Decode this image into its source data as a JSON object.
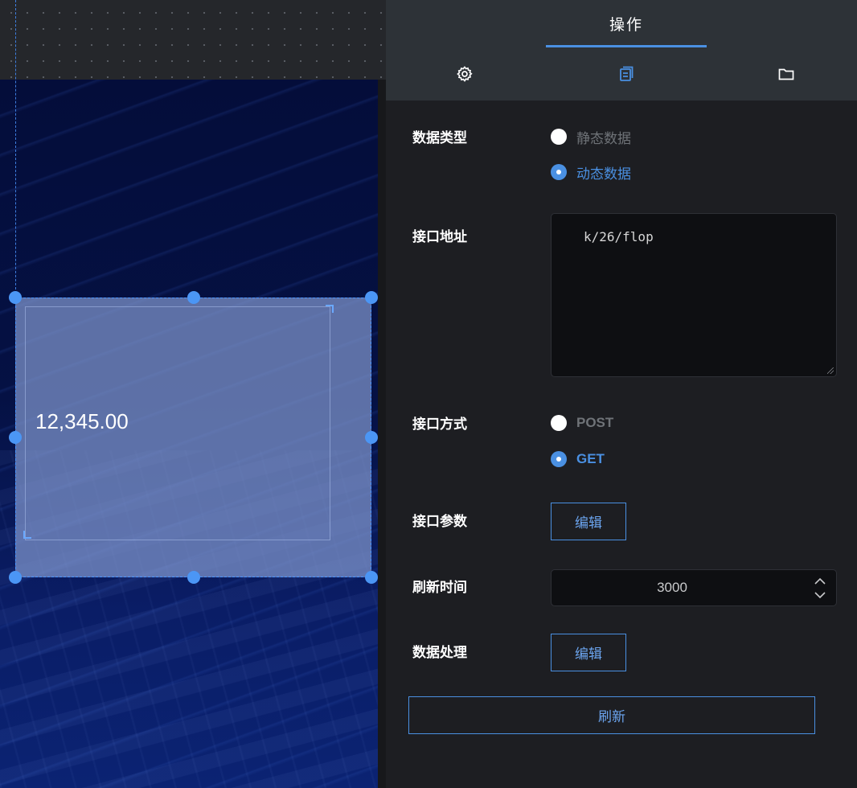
{
  "canvas": {
    "component": {
      "value": "12,345.00"
    }
  },
  "panel": {
    "title": "操作",
    "tabs": [
      {
        "icon": "gear-icon"
      },
      {
        "icon": "data-icon"
      },
      {
        "icon": "folder-icon"
      }
    ],
    "data_type": {
      "label": "数据类型",
      "options": [
        "静态数据",
        "动态数据"
      ],
      "selected": "动态数据"
    },
    "api_url": {
      "label": "接口地址",
      "value": "k/26/flop"
    },
    "api_method": {
      "label": "接口方式",
      "options": [
        "POST",
        "GET"
      ],
      "selected": "GET"
    },
    "api_params": {
      "label": "接口参数",
      "button": "编辑"
    },
    "refresh_time": {
      "label": "刷新时间",
      "value": "3000"
    },
    "data_processing": {
      "label": "数据处理",
      "button": "编辑"
    },
    "refresh_button": "刷新"
  },
  "colors": {
    "accent": "#4a90e2",
    "panel_bg": "#1d1e22",
    "header_bg": "#2d3237",
    "stage_bg": "#051144"
  }
}
